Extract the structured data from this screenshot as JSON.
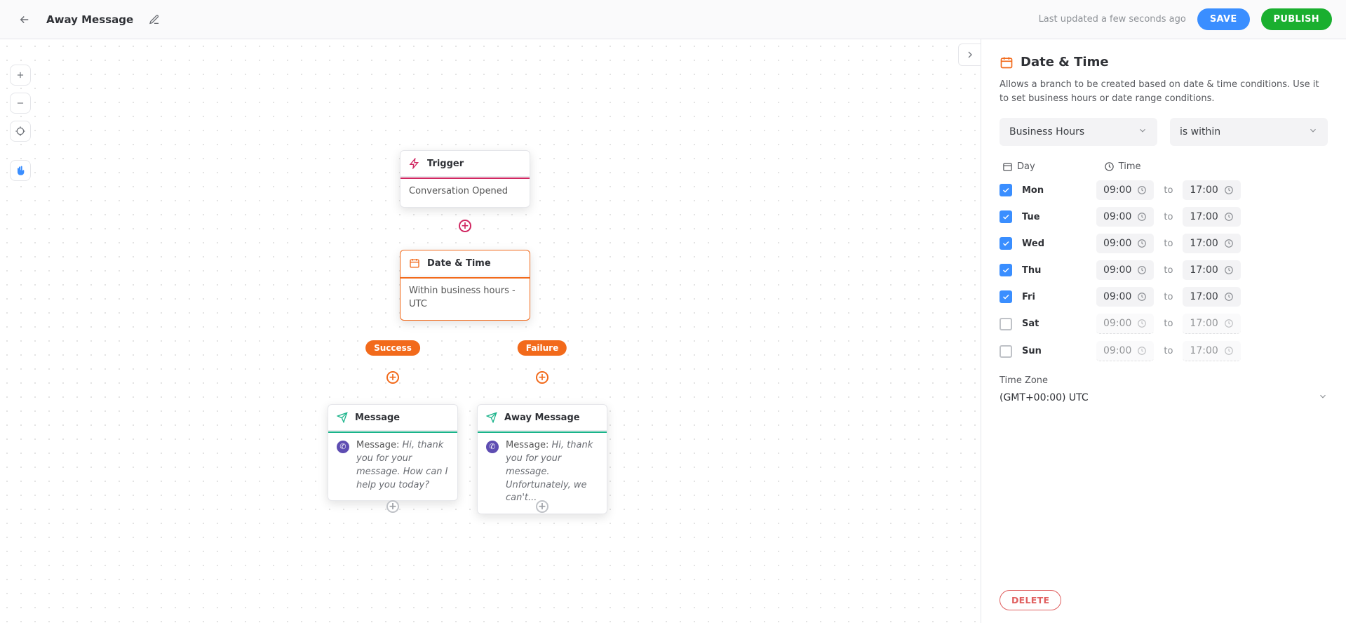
{
  "header": {
    "title": "Away Message",
    "status": "Last updated a few seconds ago",
    "save": "SAVE",
    "publish": "PUBLISH"
  },
  "flow": {
    "trigger": {
      "title": "Trigger",
      "body": "Conversation Opened"
    },
    "datetime": {
      "title": "Date & Time",
      "body": "Within business hours - UTC"
    },
    "branch": {
      "success": "Success",
      "failure": "Failure"
    },
    "msg_left": {
      "title": "Message",
      "prefix": "Message: ",
      "text": "Hi, thank you for your message. How can I help you today?"
    },
    "msg_right": {
      "title": "Away Message",
      "prefix": "Message: ",
      "text": "Hi, thank you for your message. Unfortunately, we can't..."
    }
  },
  "panel": {
    "heading": "Date & Time",
    "desc": "Allows a branch to be created based on date & time conditions. Use it to set business hours or date range conditions.",
    "select1": "Business Hours",
    "select2": "is within",
    "col_day": "Day",
    "col_time": "Time",
    "to": "to",
    "tz_label": "Time Zone",
    "tz_value": "(GMT+00:00) UTC",
    "delete": "DELETE",
    "days": [
      {
        "name": "Mon",
        "on": true,
        "from": "09:00",
        "to": "17:00"
      },
      {
        "name": "Tue",
        "on": true,
        "from": "09:00",
        "to": "17:00"
      },
      {
        "name": "Wed",
        "on": true,
        "from": "09:00",
        "to": "17:00"
      },
      {
        "name": "Thu",
        "on": true,
        "from": "09:00",
        "to": "17:00"
      },
      {
        "name": "Fri",
        "on": true,
        "from": "09:00",
        "to": "17:00"
      },
      {
        "name": "Sat",
        "on": false,
        "from": "09:00",
        "to": "17:00"
      },
      {
        "name": "Sun",
        "on": false,
        "from": "09:00",
        "to": "17:00"
      }
    ]
  }
}
